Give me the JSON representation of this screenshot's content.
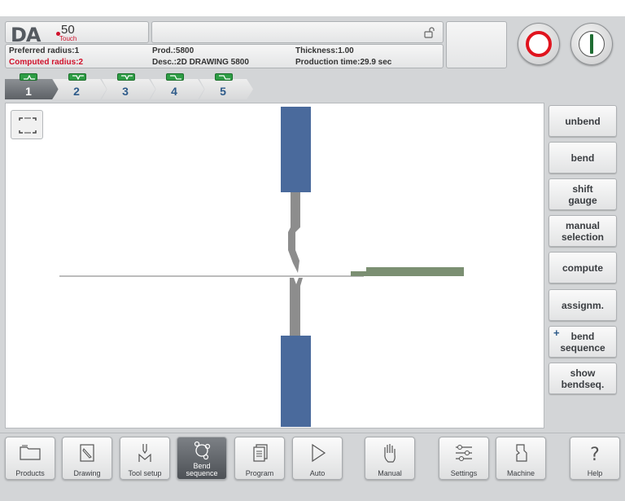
{
  "logo": {
    "brand": "DA",
    "model": "50",
    "sub": "Touch"
  },
  "info": {
    "preferred_radius": "Preferred radius:1",
    "computed_radius": "Computed radius:2",
    "prod": "Prod.:5800",
    "desc": "Desc.:2D DRAWING 5800",
    "thickness": "Thickness:1.00",
    "production_time": "Production time:29.9 sec"
  },
  "bend_tabs": [
    {
      "label": "1",
      "active": true
    },
    {
      "label": "2",
      "active": false
    },
    {
      "label": "3",
      "active": false
    },
    {
      "label": "4",
      "active": false
    },
    {
      "label": "5",
      "active": false
    }
  ],
  "side_buttons": [
    {
      "label": "unbend"
    },
    {
      "label": "bend"
    },
    {
      "label": "shift\ngauge"
    },
    {
      "label": "manual\nselection"
    },
    {
      "label": "compute"
    },
    {
      "label": "assignm."
    },
    {
      "label": "bend\nsequence"
    },
    {
      "label": "show\nbendseq."
    }
  ],
  "nav": [
    {
      "label": "Products",
      "icon": "folder-icon"
    },
    {
      "label": "Drawing",
      "icon": "pencil-icon"
    },
    {
      "label": "Tool setup",
      "icon": "tool-icon"
    },
    {
      "label": "Bend sequence",
      "icon": "bend-sequence-icon",
      "active": true
    },
    {
      "label": "Program",
      "icon": "program-icon"
    },
    {
      "label": "Auto",
      "icon": "play-icon"
    },
    {
      "label": "Manual",
      "icon": "hand-icon"
    },
    {
      "label": "Settings",
      "icon": "settings-icon"
    },
    {
      "label": "Machine",
      "icon": "machine-icon"
    },
    {
      "label": "Help",
      "icon": "help-icon"
    }
  ],
  "colors": {
    "tool_blue": "#4a6a9c",
    "tool_gray": "#8d8d8d",
    "sheet_green": "#7b8f72",
    "stop_red": "#e0141e",
    "start_green": "#1f6d33"
  }
}
